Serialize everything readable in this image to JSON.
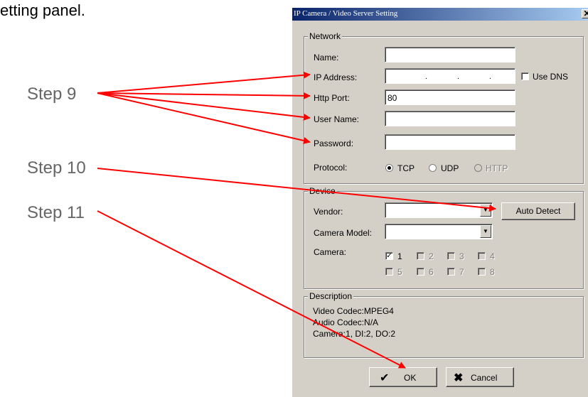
{
  "intro_text": "etting panel.",
  "steps": [
    "Step 9",
    "Step 10",
    "Step 11"
  ],
  "dialog": {
    "title": "IP Camera / Video Server Setting",
    "close_glyph": "✕",
    "network": {
      "group_label": "Network",
      "name_label": "Name:",
      "name_value": "",
      "ip_label": "IP Address:",
      "ip_dot": ".",
      "use_dns_label": "Use DNS",
      "use_dns_checked": false,
      "port_label": "Http Port:",
      "port_value": "80",
      "user_label": "User Name:",
      "user_value": "",
      "password_label": "Password:",
      "password_value": "",
      "protocol_label": "Protocol:",
      "protocols": [
        {
          "label": "TCP",
          "selected": true,
          "enabled": true
        },
        {
          "label": "UDP",
          "selected": false,
          "enabled": true
        },
        {
          "label": "HTTP",
          "selected": false,
          "enabled": false
        }
      ]
    },
    "device": {
      "group_label": "Device",
      "vendor_label": "Vendor:",
      "vendor_value": "",
      "auto_detect_label": "Auto Detect",
      "model_label": "Camera Model:",
      "model_value": "",
      "camera_label": "Camera:",
      "cameras": [
        {
          "label": "1",
          "checked": true,
          "enabled": true
        },
        {
          "label": "2",
          "checked": false,
          "enabled": false
        },
        {
          "label": "3",
          "checked": false,
          "enabled": false
        },
        {
          "label": "4",
          "checked": false,
          "enabled": false
        },
        {
          "label": "5",
          "checked": false,
          "enabled": false
        },
        {
          "label": "6",
          "checked": false,
          "enabled": false
        },
        {
          "label": "7",
          "checked": false,
          "enabled": false
        },
        {
          "label": "8",
          "checked": false,
          "enabled": false
        }
      ]
    },
    "description": {
      "group_label": "Description",
      "lines": [
        "Video Codec:MPEG4",
        "Audio Codec:N/A",
        "Camera:1, DI:2, DO:2"
      ]
    },
    "ok_label": "OK",
    "cancel_label": "Cancel"
  },
  "colors": {
    "arrow": "#ff0000",
    "title_start": "#0a246a",
    "title_end": "#a6caf0",
    "dialog_bg": "#d4d0c8",
    "step_text": "#666666"
  }
}
